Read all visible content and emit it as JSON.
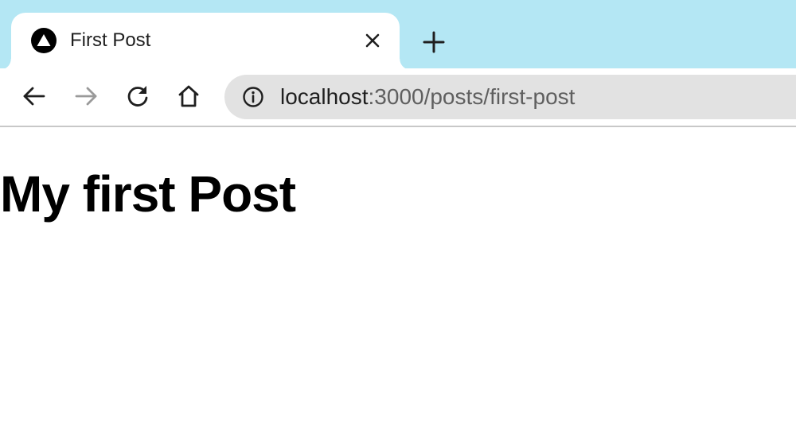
{
  "browser": {
    "tab": {
      "title": "First Post",
      "favicon": "triangle-logo-icon"
    },
    "toolbar": {
      "back_icon": "arrow-left-icon",
      "forward_icon": "arrow-right-icon",
      "reload_icon": "reload-icon",
      "home_icon": "home-icon"
    },
    "address_bar": {
      "host": "localhost",
      "rest": ":3000/posts/first-post",
      "info_icon": "info-icon"
    },
    "colors": {
      "tabstrip": "#b4e7f4",
      "omnibox": "#e2e2e2"
    }
  },
  "page": {
    "heading": "My first Post"
  }
}
